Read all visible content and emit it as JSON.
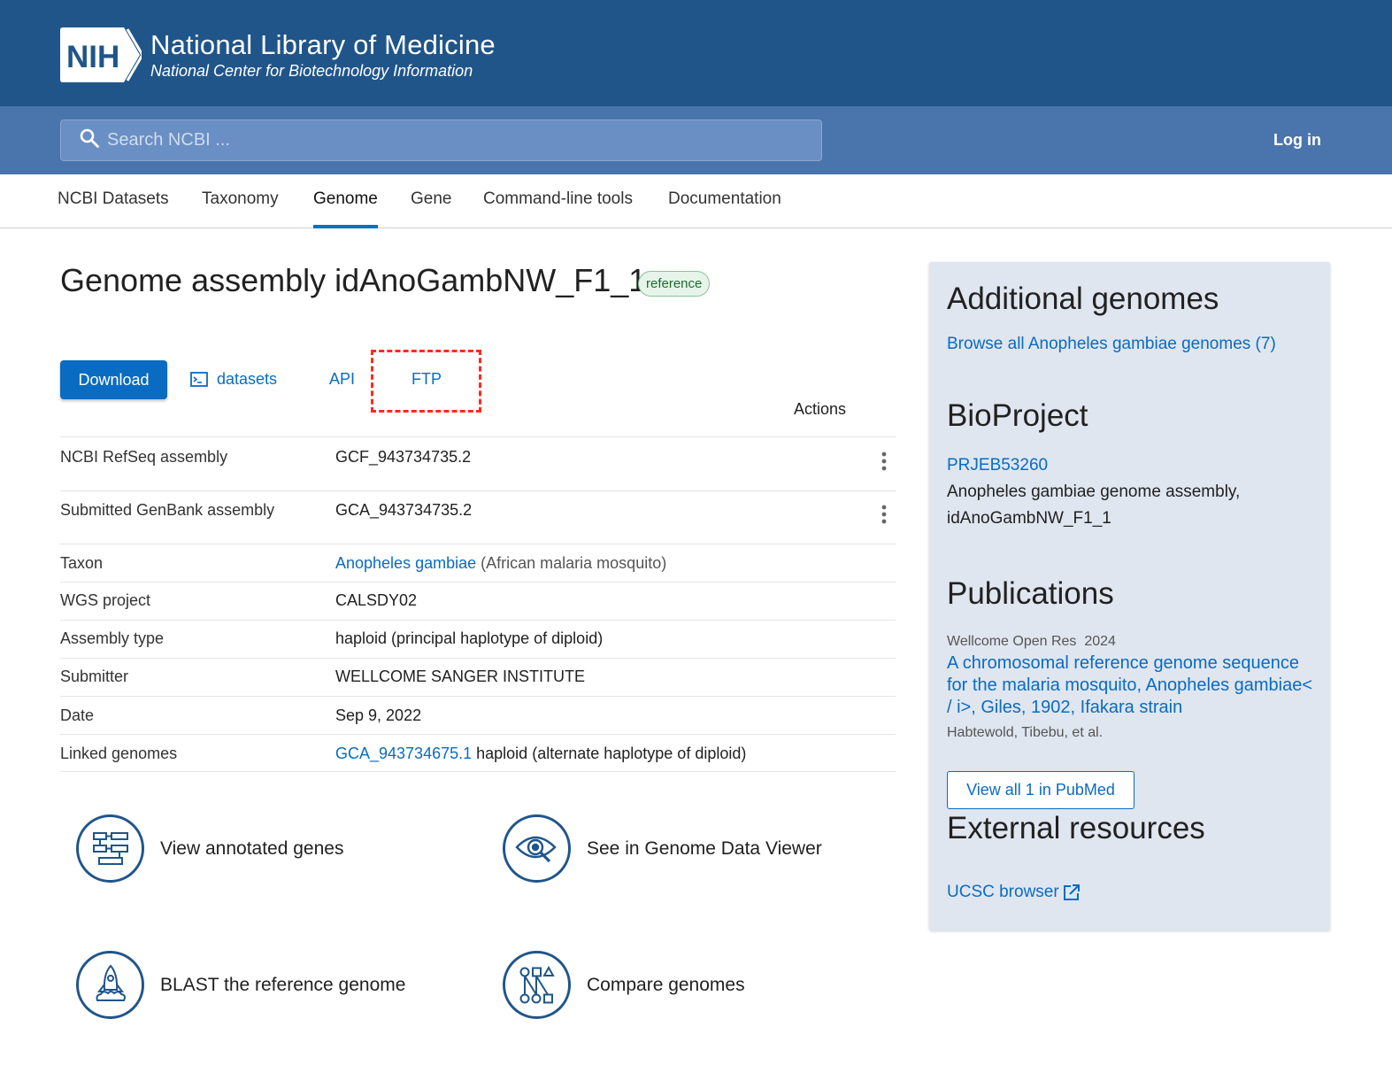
{
  "header": {
    "logo_mark": "NIH",
    "title": "National Library of Medicine",
    "subtitle": "National Center for Biotechnology Information",
    "search_placeholder": "Search NCBI ...",
    "login_label": "Log in"
  },
  "tabs": [
    {
      "label": "NCBI Datasets"
    },
    {
      "label": "Taxonomy"
    },
    {
      "label": "Genome",
      "active": true
    },
    {
      "label": "Gene"
    },
    {
      "label": "Command-line tools"
    },
    {
      "label": "Documentation"
    }
  ],
  "main": {
    "title": "Genome assembly idAnoGambNW_F1_1",
    "badge": "reference",
    "actions": {
      "download_label": "Download",
      "datasets_label": "datasets",
      "api_label": "API",
      "ftp_label": "FTP",
      "actions_header": "Actions"
    },
    "rows": [
      {
        "label": "NCBI RefSeq assembly",
        "value": "GCF_943734735.2"
      },
      {
        "label": "Submitted GenBank assembly",
        "value": "GCA_943734735.2"
      },
      {
        "label": "Taxon",
        "link": "Anopheles gambiae",
        "value": "(African malaria mosquito)"
      },
      {
        "label": "WGS project",
        "link": "CALSDY02"
      },
      {
        "label": "Assembly type",
        "value": "haploid (principal haplotype of diploid)"
      },
      {
        "label": "Submitter",
        "value": "WELLCOME SANGER INSTITUTE"
      },
      {
        "label": "Date",
        "value": "Sep 9, 2022"
      },
      {
        "label": "Linked genomes",
        "link": "GCA_943734675.1",
        "value": "haploid (alternate haplotype of diploid)"
      }
    ],
    "features": [
      {
        "label": "View annotated genes",
        "icon": "gene-annotation-icon"
      },
      {
        "label": "See in Genome Data Viewer",
        "icon": "eye-magnifier-icon"
      },
      {
        "label": "BLAST the reference genome",
        "icon": "rocket-icon"
      },
      {
        "label": "Compare genomes",
        "icon": "compare-genomes-icon"
      }
    ]
  },
  "sidebar": {
    "additional_heading": "Additional genomes",
    "additional_link": "Browse all Anopheles gambiae genomes (7)",
    "bioproject_heading": "BioProject",
    "bioproject_id": "PRJEB53260",
    "bioproject_desc": "Anopheles gambiae genome assembly, idAnoGambNW_F1_1",
    "publications_heading": "Publications",
    "pub_journal": "Wellcome Open Res",
    "pub_year": "2024",
    "pub_title": "A chromosomal reference genome sequence for the malaria mosquito, Anopheles gambiae< / i>, Giles, 1902, Ifakara strain",
    "pub_authors": "Habtewold, Tibebu, et al.",
    "pubmed_button": "View all 1 in PubMed",
    "external_heading": "External resources",
    "external_link": "UCSC browser"
  },
  "colors": {
    "banner": "#20558a",
    "search_band": "#4a74ac",
    "link": "#0a6bc2",
    "highlight": "#ff2a1a",
    "sidebar_bg": "#dfe6f0"
  }
}
